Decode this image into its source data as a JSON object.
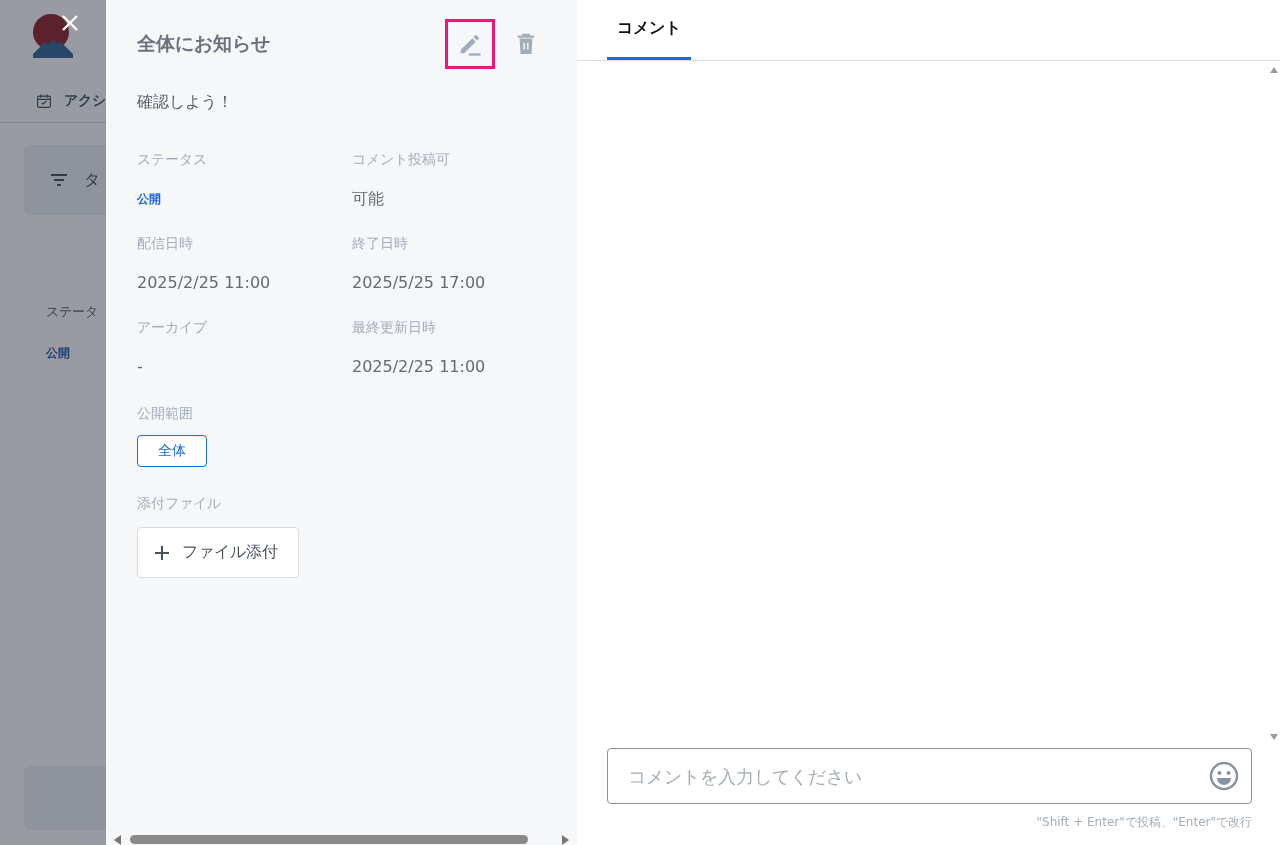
{
  "background": {
    "nav_item": "アクシ",
    "filter_label": "タ",
    "status_label": "ステータ",
    "status_value": "公開"
  },
  "drawer": {
    "title": "全体にお知らせ",
    "actions": [
      {
        "kind": "edit",
        "highlighted": true
      },
      {
        "kind": "delete",
        "highlighted": false
      }
    ],
    "body": "確認しよう！",
    "fields": [
      {
        "label": "ステータス",
        "value": "公開",
        "kind": "status"
      },
      {
        "label": "コメント投稿可",
        "value": "可能",
        "kind": "text"
      },
      {
        "label": "配信日時",
        "value": "2025/2/25 11:00",
        "kind": "text"
      },
      {
        "label": "終了日時",
        "value": "2025/5/25 17:00",
        "kind": "text"
      },
      {
        "label": "アーカイブ",
        "value": "-",
        "kind": "text"
      },
      {
        "label": "最終更新日時",
        "value": "2025/2/25 11:00",
        "kind": "text"
      }
    ],
    "scope": {
      "label": "公開範囲",
      "tags": [
        "全体"
      ]
    },
    "attachments": {
      "label": "添付ファイル",
      "button": "ファイル添付"
    }
  },
  "comments": {
    "tabs": [
      {
        "label": "コメント",
        "selected": true
      }
    ],
    "input": {
      "placeholder": "コメントを入力してください"
    },
    "hint": "\"Shift + Enter\"で投稿、\"Enter\"で改行"
  }
}
